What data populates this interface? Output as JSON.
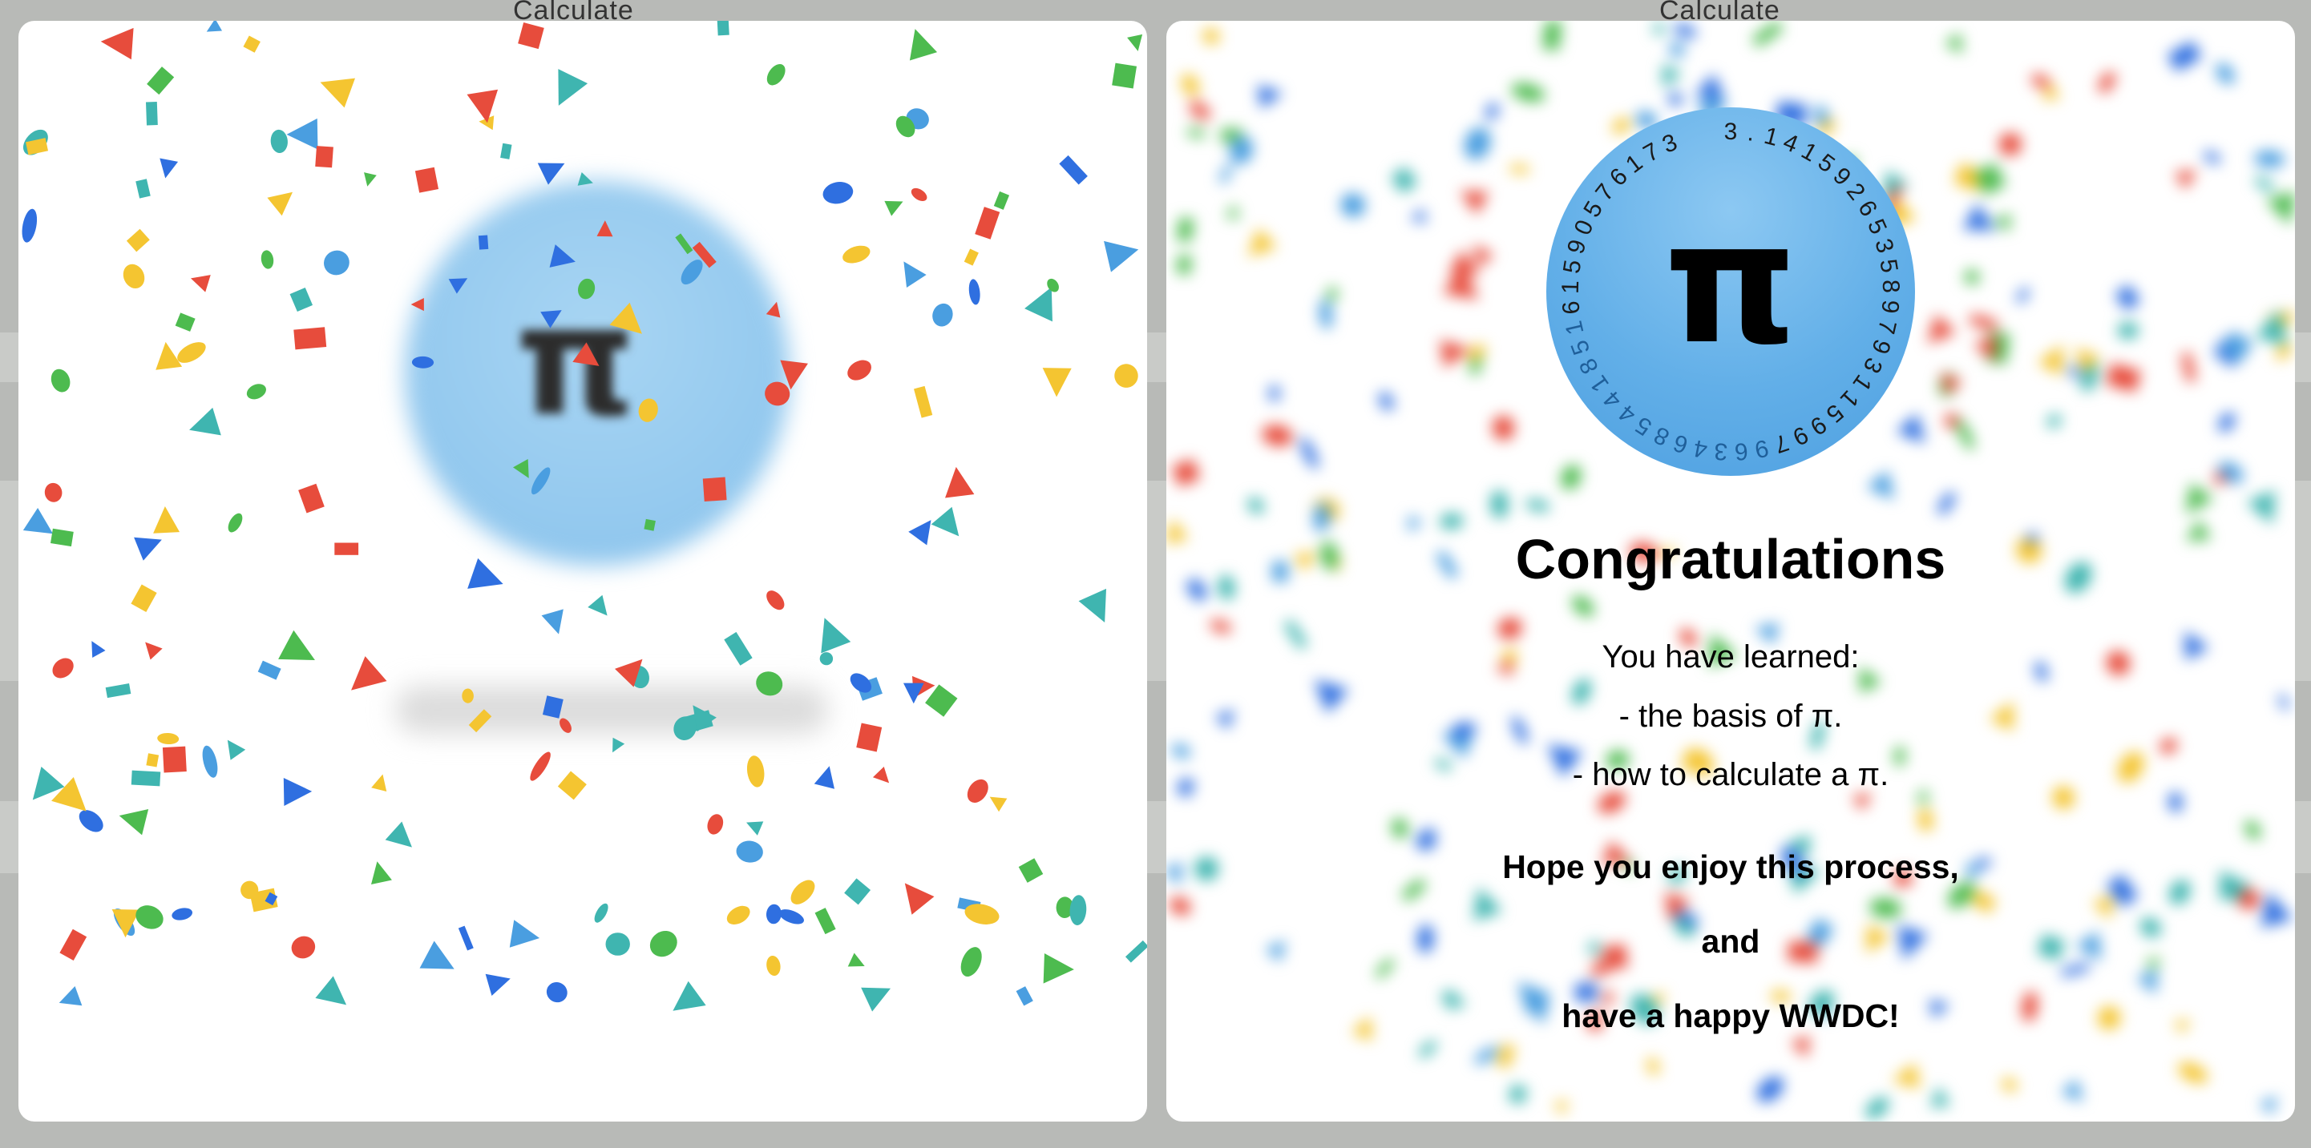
{
  "window": {
    "left_title": "Calculate",
    "right_title": "Calculate"
  },
  "badge": {
    "symbol": "π",
    "ring_digits": "3.141592653589793115997963468544185161590576173"
  },
  "congrats": {
    "title": "Congratulations",
    "learned_label": "You have learned:",
    "learned_items": [
      "- the basis of π.",
      "- how to calculate a π."
    ],
    "closing_lines": [
      "Hope you enjoy this process,",
      "and",
      "have a happy WWDC!"
    ]
  },
  "colors": {
    "badge_blue": "#5eabe6",
    "confetti": [
      "#e74c3c",
      "#2f6fe0",
      "#f4c531",
      "#4dbb4f",
      "#3fb5b0",
      "#4a9ee0"
    ]
  }
}
